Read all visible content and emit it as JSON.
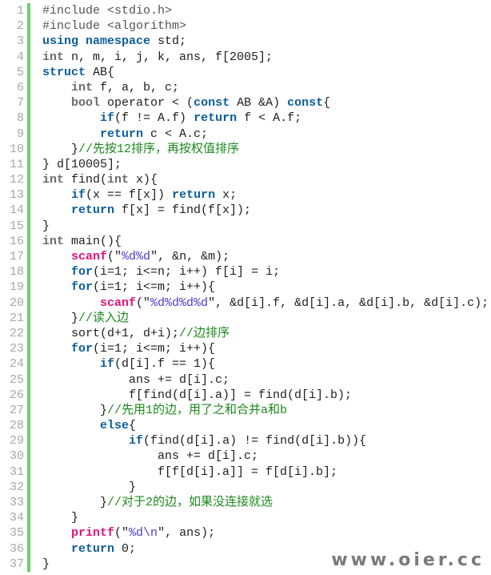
{
  "editor": {
    "colors": {
      "keyword": "#0b5e9a",
      "type": "#6b6b6b",
      "function": "#e0137d",
      "string": "#4b3bd1",
      "comment": "#1c8a1c",
      "gutter_bar": "#6ccf6c",
      "line_number": "#a8a8a8"
    },
    "lines": [
      {
        "n": "1",
        "tokens": [
          [
            "pre",
            "#include <stdio.h>"
          ]
        ]
      },
      {
        "n": "2",
        "tokens": [
          [
            "pre",
            "#include <algorithm>"
          ]
        ]
      },
      {
        "n": "3",
        "tokens": [
          [
            "kw",
            "using namespace"
          ],
          [
            "plain",
            " std;"
          ]
        ]
      },
      {
        "n": "4",
        "tokens": [
          [
            "type",
            "int"
          ],
          [
            "plain",
            " n, m, i, j, k, ans, f[2005];"
          ]
        ]
      },
      {
        "n": "5",
        "tokens": [
          [
            "kw",
            "struct"
          ],
          [
            "plain",
            " AB{"
          ]
        ]
      },
      {
        "n": "6",
        "tokens": [
          [
            "plain",
            "    "
          ],
          [
            "type",
            "int"
          ],
          [
            "plain",
            " f, a, b, c;"
          ]
        ]
      },
      {
        "n": "7",
        "tokens": [
          [
            "plain",
            "    "
          ],
          [
            "type",
            "bool"
          ],
          [
            "plain",
            " operator < ("
          ],
          [
            "kw",
            "const"
          ],
          [
            "plain",
            " AB &A) "
          ],
          [
            "kw",
            "const"
          ],
          [
            "plain",
            "{"
          ]
        ]
      },
      {
        "n": "8",
        "tokens": [
          [
            "plain",
            "        "
          ],
          [
            "kw",
            "if"
          ],
          [
            "plain",
            "(f != A.f) "
          ],
          [
            "kw",
            "return"
          ],
          [
            "plain",
            " f < A.f;"
          ]
        ]
      },
      {
        "n": "9",
        "tokens": [
          [
            "plain",
            "        "
          ],
          [
            "kw",
            "return"
          ],
          [
            "plain",
            " c < A.c;"
          ]
        ]
      },
      {
        "n": "10",
        "tokens": [
          [
            "plain",
            "    }"
          ],
          [
            "cm",
            "//先按12排序，再按权值排序"
          ]
        ]
      },
      {
        "n": "11",
        "tokens": [
          [
            "plain",
            "} d[10005];"
          ]
        ]
      },
      {
        "n": "12",
        "tokens": [
          [
            "type",
            "int"
          ],
          [
            "plain",
            " find("
          ],
          [
            "type",
            "int"
          ],
          [
            "plain",
            " x){"
          ]
        ]
      },
      {
        "n": "13",
        "tokens": [
          [
            "plain",
            "    "
          ],
          [
            "kw",
            "if"
          ],
          [
            "plain",
            "(x == f[x]) "
          ],
          [
            "kw",
            "return"
          ],
          [
            "plain",
            " x;"
          ]
        ]
      },
      {
        "n": "14",
        "tokens": [
          [
            "plain",
            "    "
          ],
          [
            "kw",
            "return"
          ],
          [
            "plain",
            " f[x] = find(f[x]);"
          ]
        ]
      },
      {
        "n": "15",
        "tokens": [
          [
            "plain",
            "}"
          ]
        ]
      },
      {
        "n": "16",
        "tokens": [
          [
            "type",
            "int"
          ],
          [
            "plain",
            " main(){"
          ]
        ]
      },
      {
        "n": "17",
        "tokens": [
          [
            "plain",
            "    "
          ],
          [
            "fn",
            "scanf"
          ],
          [
            "plain",
            "(\""
          ],
          [
            "str",
            "%d%d"
          ],
          [
            "plain",
            "\", &n, &m);"
          ]
        ]
      },
      {
        "n": "18",
        "tokens": [
          [
            "plain",
            "    "
          ],
          [
            "kw",
            "for"
          ],
          [
            "plain",
            "(i=1; i<=n; i++) f[i] = i;"
          ]
        ]
      },
      {
        "n": "19",
        "tokens": [
          [
            "plain",
            "    "
          ],
          [
            "kw",
            "for"
          ],
          [
            "plain",
            "(i=1; i<=m; i++){"
          ]
        ]
      },
      {
        "n": "20",
        "tokens": [
          [
            "plain",
            "        "
          ],
          [
            "fn",
            "scanf"
          ],
          [
            "plain",
            "(\""
          ],
          [
            "str",
            "%d%d%d%d"
          ],
          [
            "plain",
            "\", &d[i].f, &d[i].a, &d[i].b, &d[i].c);"
          ]
        ]
      },
      {
        "n": "21",
        "tokens": [
          [
            "plain",
            "    }"
          ],
          [
            "cm",
            "//读入边"
          ]
        ]
      },
      {
        "n": "22",
        "tokens": [
          [
            "plain",
            "    sort(d+1, d+i);"
          ],
          [
            "cm",
            "//边排序"
          ]
        ]
      },
      {
        "n": "23",
        "tokens": [
          [
            "plain",
            "    "
          ],
          [
            "kw",
            "for"
          ],
          [
            "plain",
            "(i=1; i<=m; i++){"
          ]
        ]
      },
      {
        "n": "24",
        "tokens": [
          [
            "plain",
            "        "
          ],
          [
            "kw",
            "if"
          ],
          [
            "plain",
            "(d[i].f == 1){"
          ]
        ]
      },
      {
        "n": "25",
        "tokens": [
          [
            "plain",
            "            ans += d[i].c;"
          ]
        ]
      },
      {
        "n": "26",
        "tokens": [
          [
            "plain",
            "            f[find(d[i].a)] = find(d[i].b);"
          ]
        ]
      },
      {
        "n": "27",
        "tokens": [
          [
            "plain",
            "        }"
          ],
          [
            "cm",
            "//先用1的边，用了之和合并a和b"
          ]
        ]
      },
      {
        "n": "28",
        "tokens": [
          [
            "plain",
            "        "
          ],
          [
            "kw",
            "else"
          ],
          [
            "plain",
            "{"
          ]
        ]
      },
      {
        "n": "29",
        "tokens": [
          [
            "plain",
            "            "
          ],
          [
            "kw",
            "if"
          ],
          [
            "plain",
            "(find(d[i].a) != find(d[i].b)){"
          ]
        ]
      },
      {
        "n": "30",
        "tokens": [
          [
            "plain",
            "                ans += d[i].c;"
          ]
        ]
      },
      {
        "n": "31",
        "tokens": [
          [
            "plain",
            "                f[f[d[i].a]] = f[d[i].b];"
          ]
        ]
      },
      {
        "n": "32",
        "tokens": [
          [
            "plain",
            "            }"
          ]
        ]
      },
      {
        "n": "33",
        "tokens": [
          [
            "plain",
            "        }"
          ],
          [
            "cm",
            "//对于2的边，如果没连接就选"
          ]
        ]
      },
      {
        "n": "34",
        "tokens": [
          [
            "plain",
            "    }"
          ]
        ]
      },
      {
        "n": "35",
        "tokens": [
          [
            "plain",
            "    "
          ],
          [
            "fn",
            "printf"
          ],
          [
            "plain",
            "(\""
          ],
          [
            "str",
            "%d\\n"
          ],
          [
            "plain",
            "\", ans);"
          ]
        ]
      },
      {
        "n": "36",
        "tokens": [
          [
            "plain",
            "    "
          ],
          [
            "kw",
            "return"
          ],
          [
            "plain",
            " 0;"
          ]
        ]
      },
      {
        "n": "37",
        "tokens": [
          [
            "plain",
            "}"
          ]
        ]
      }
    ]
  },
  "watermark": "www.oier.cc"
}
